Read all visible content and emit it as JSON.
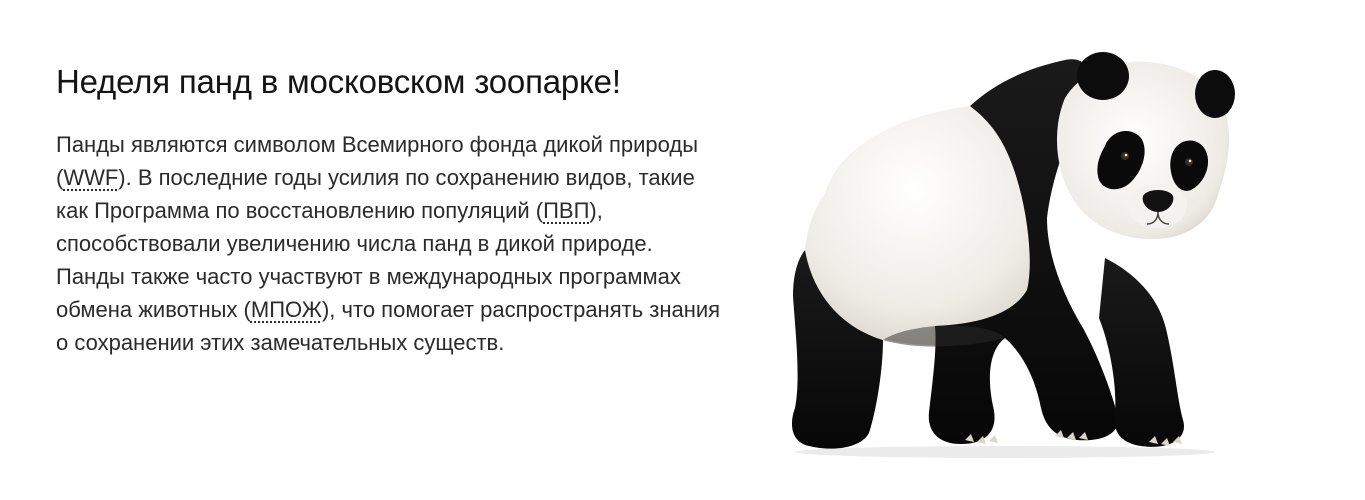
{
  "title": "Неделя панд в московском зоопарке!",
  "paragraph": {
    "t1": "Панды являются символом Всемирного фонда дикой природы (",
    "abbr1": "WWF",
    "t2": "). В последние годы усилия по сохранению видов, такие как Программа по восстановлению популяций (",
    "abbr2": "ПВП",
    "t3": "), способствовали увеличению числа панд в дикой природе. Панды также часто участвуют в международных программах обмена животных (",
    "abbr3": "МПОЖ",
    "t4": "), что помогает распространять знания о сохранении этих замечательных существ."
  },
  "image": {
    "subject": "giant-panda"
  },
  "colors": {
    "background": "#ffffff",
    "text": "#1a1a1a",
    "fur_black": "#0f0f0f",
    "fur_white": "#f2f0eb"
  }
}
